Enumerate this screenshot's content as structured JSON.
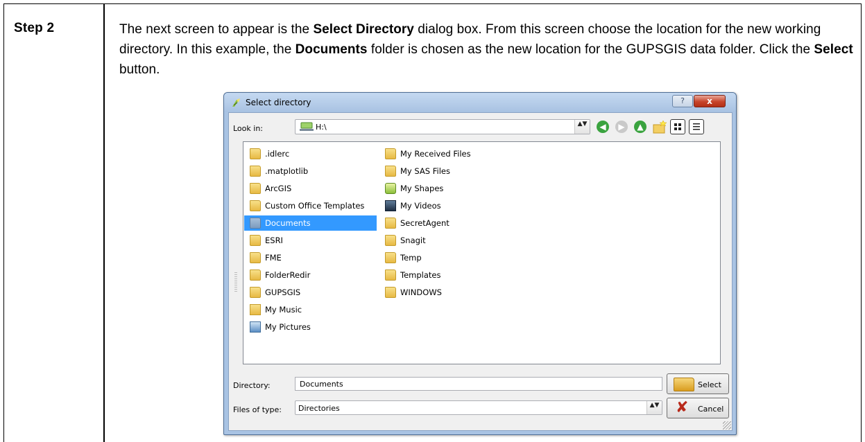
{
  "step_label": "Step 2",
  "instructions": {
    "p1": "The next screen to appear is the ",
    "b1": "Select Directory",
    "p2": " dialog box. From this screen choose the location for the new working directory. In this example, the ",
    "b2": "Documents",
    "p3": " folder is chosen as the new location for the GUPSGIS data folder. Click the ",
    "b3": "Select",
    "p4": " button."
  },
  "dialog": {
    "title": "Select directory",
    "help_label": "?",
    "close_label": "x",
    "look_in_label": "Look in:",
    "look_in_value": "H:\\",
    "combo_arrow": "▲▼",
    "back_glyph": "◀",
    "forward_glyph": "▶",
    "up_glyph": "▲",
    "files_left": [
      ".idlerc",
      ".matplotlib",
      "ArcGIS",
      "Custom Office Templates",
      "Documents",
      "ESRI",
      "FME",
      "FolderRedir",
      "GUPSGIS",
      "My Music",
      "My Pictures"
    ],
    "files_right": [
      "My Received Files",
      "My SAS Files",
      "My Shapes",
      "My Videos",
      "SecretAgent",
      "Snagit",
      "Temp",
      "Templates",
      "WINDOWS"
    ],
    "selected_item": "Documents",
    "directory_label": "Directory:",
    "directory_value": "Documents",
    "files_of_type_label": "Files of type:",
    "files_of_type_value": "Directories",
    "select_button": "Select",
    "cancel_button": "Cancel"
  },
  "colors": {
    "selection": "#3399ff",
    "frame": "#a9c3e3",
    "close": "#c7452b"
  }
}
